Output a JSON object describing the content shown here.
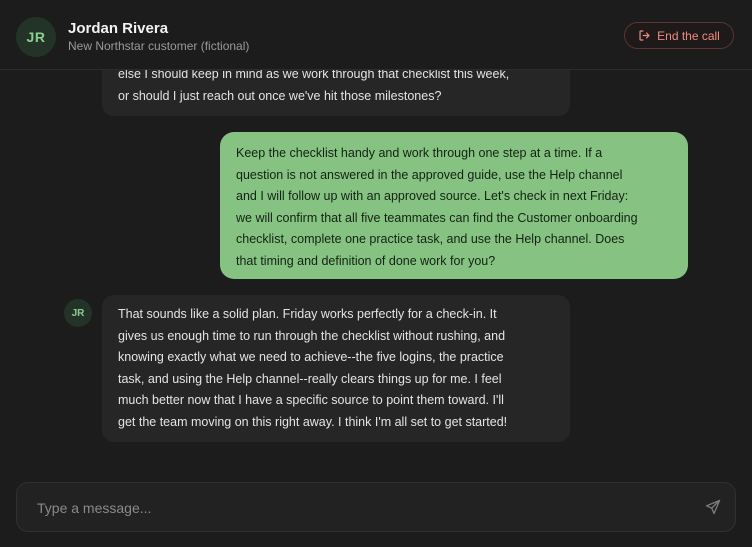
{
  "header": {
    "avatar_initials": "JR",
    "name": "Jordan Rivera",
    "subtitle": "New Northstar customer (fictional)",
    "end_call_label": "End the call",
    "end_call_icon": "exit-icon"
  },
  "messages": [
    {
      "role": "customer",
      "lines": [
        "else I should keep in mind as we work through that checklist this week,",
        "or should I just reach out once we've hit those milestones?"
      ]
    },
    {
      "role": "agent",
      "lines": [
        "Keep the checklist handy and work through one step at a time. If a",
        "question is not answered in the approved guide, use the Help channel",
        "and I will follow up with an approved source. Let's check in next Friday:",
        "we will confirm that all five teammates can find the Customer onboarding",
        "checklist, complete one practice task, and use the Help channel. Does",
        "that timing and definition of done work for you?"
      ]
    },
    {
      "role": "customer",
      "avatar_initials": "JR",
      "lines": [
        "That sounds like a solid plan. Friday works perfectly for a check-in. It",
        "gives us enough time to run through the checklist without rushing, and",
        "knowing exactly what we need to achieve--the five logins, the practice",
        "task, and using the Help channel--really clears things up for me. I feel",
        "much better now that I have a specific source to point them toward. I'll",
        "get the team moving on this right away. I think I'm all set to get started!"
      ]
    }
  ],
  "composer": {
    "placeholder": "Type a message...",
    "value": "",
    "send_icon": "send-icon"
  },
  "colors": {
    "background": "#1c1c1c",
    "agent_bubble": "#86c382",
    "customer_bubble": "#262626",
    "accent_danger": "#f08a80",
    "avatar_text": "#8bcf92"
  }
}
